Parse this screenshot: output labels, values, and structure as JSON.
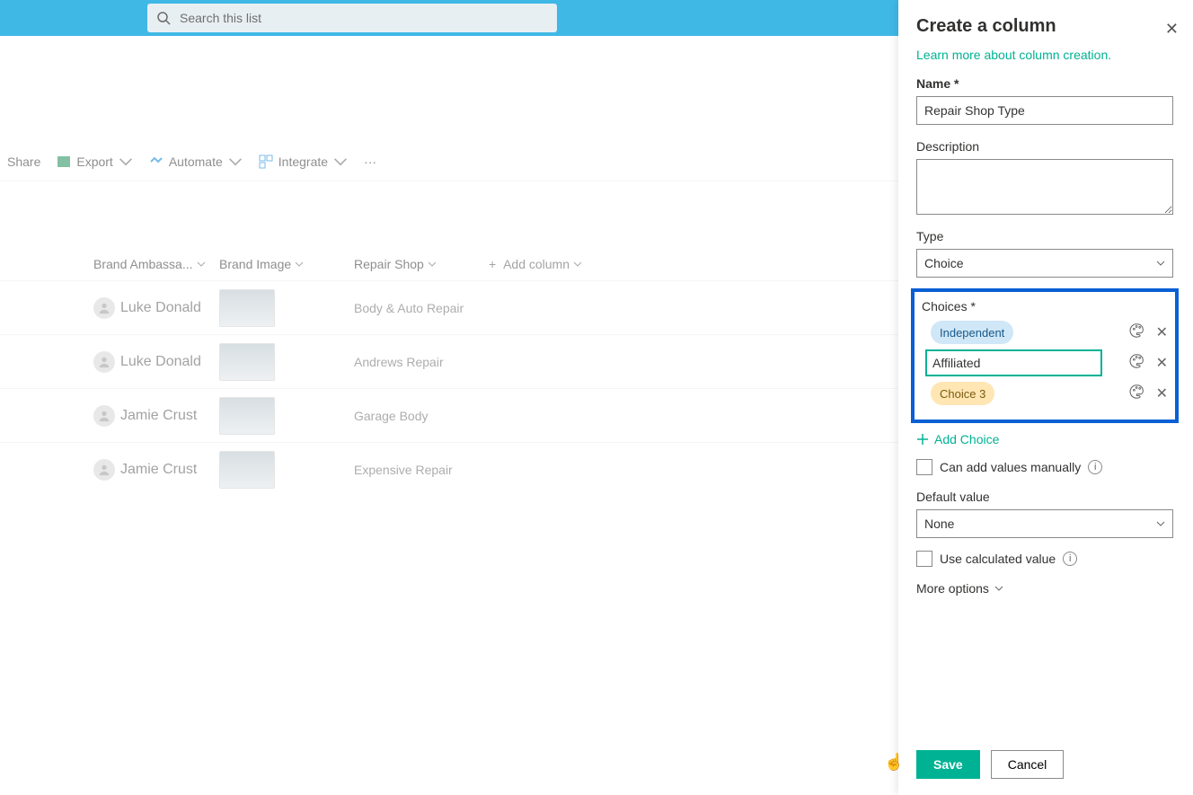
{
  "search": {
    "placeholder": "Search this list"
  },
  "cmdbar": {
    "share": "Share",
    "export": "Export",
    "automate": "Automate",
    "integrate": "Integrate"
  },
  "columns": {
    "brand_ambassador": "Brand Ambassa...",
    "brand_image": "Brand Image",
    "repair_shop": "Repair Shop",
    "add_column": "Add column"
  },
  "rows": [
    {
      "ambassador": "Luke Donald",
      "repair_shop": "Body & Auto Repair"
    },
    {
      "ambassador": "Luke Donald",
      "repair_shop": "Andrews Repair"
    },
    {
      "ambassador": "Jamie Crust",
      "repair_shop": "Garage Body"
    },
    {
      "ambassador": "Jamie Crust",
      "repair_shop": "Expensive Repair"
    }
  ],
  "panel": {
    "title": "Create a column",
    "learn_more": "Learn more about column creation.",
    "name_label": "Name",
    "name_value": "Repair Shop Type",
    "description_label": "Description",
    "description_value": "",
    "type_label": "Type",
    "type_value": "Choice",
    "choices_label": "Choices",
    "choices": {
      "c1": "Independent",
      "c2": "Affiliated",
      "c3": "Choice 3"
    },
    "add_choice": "Add Choice",
    "can_add_manually": "Can add values manually",
    "default_value_label": "Default value",
    "default_value": "None",
    "use_calculated": "Use calculated value",
    "more_options": "More options",
    "save": "Save",
    "cancel": "Cancel"
  }
}
